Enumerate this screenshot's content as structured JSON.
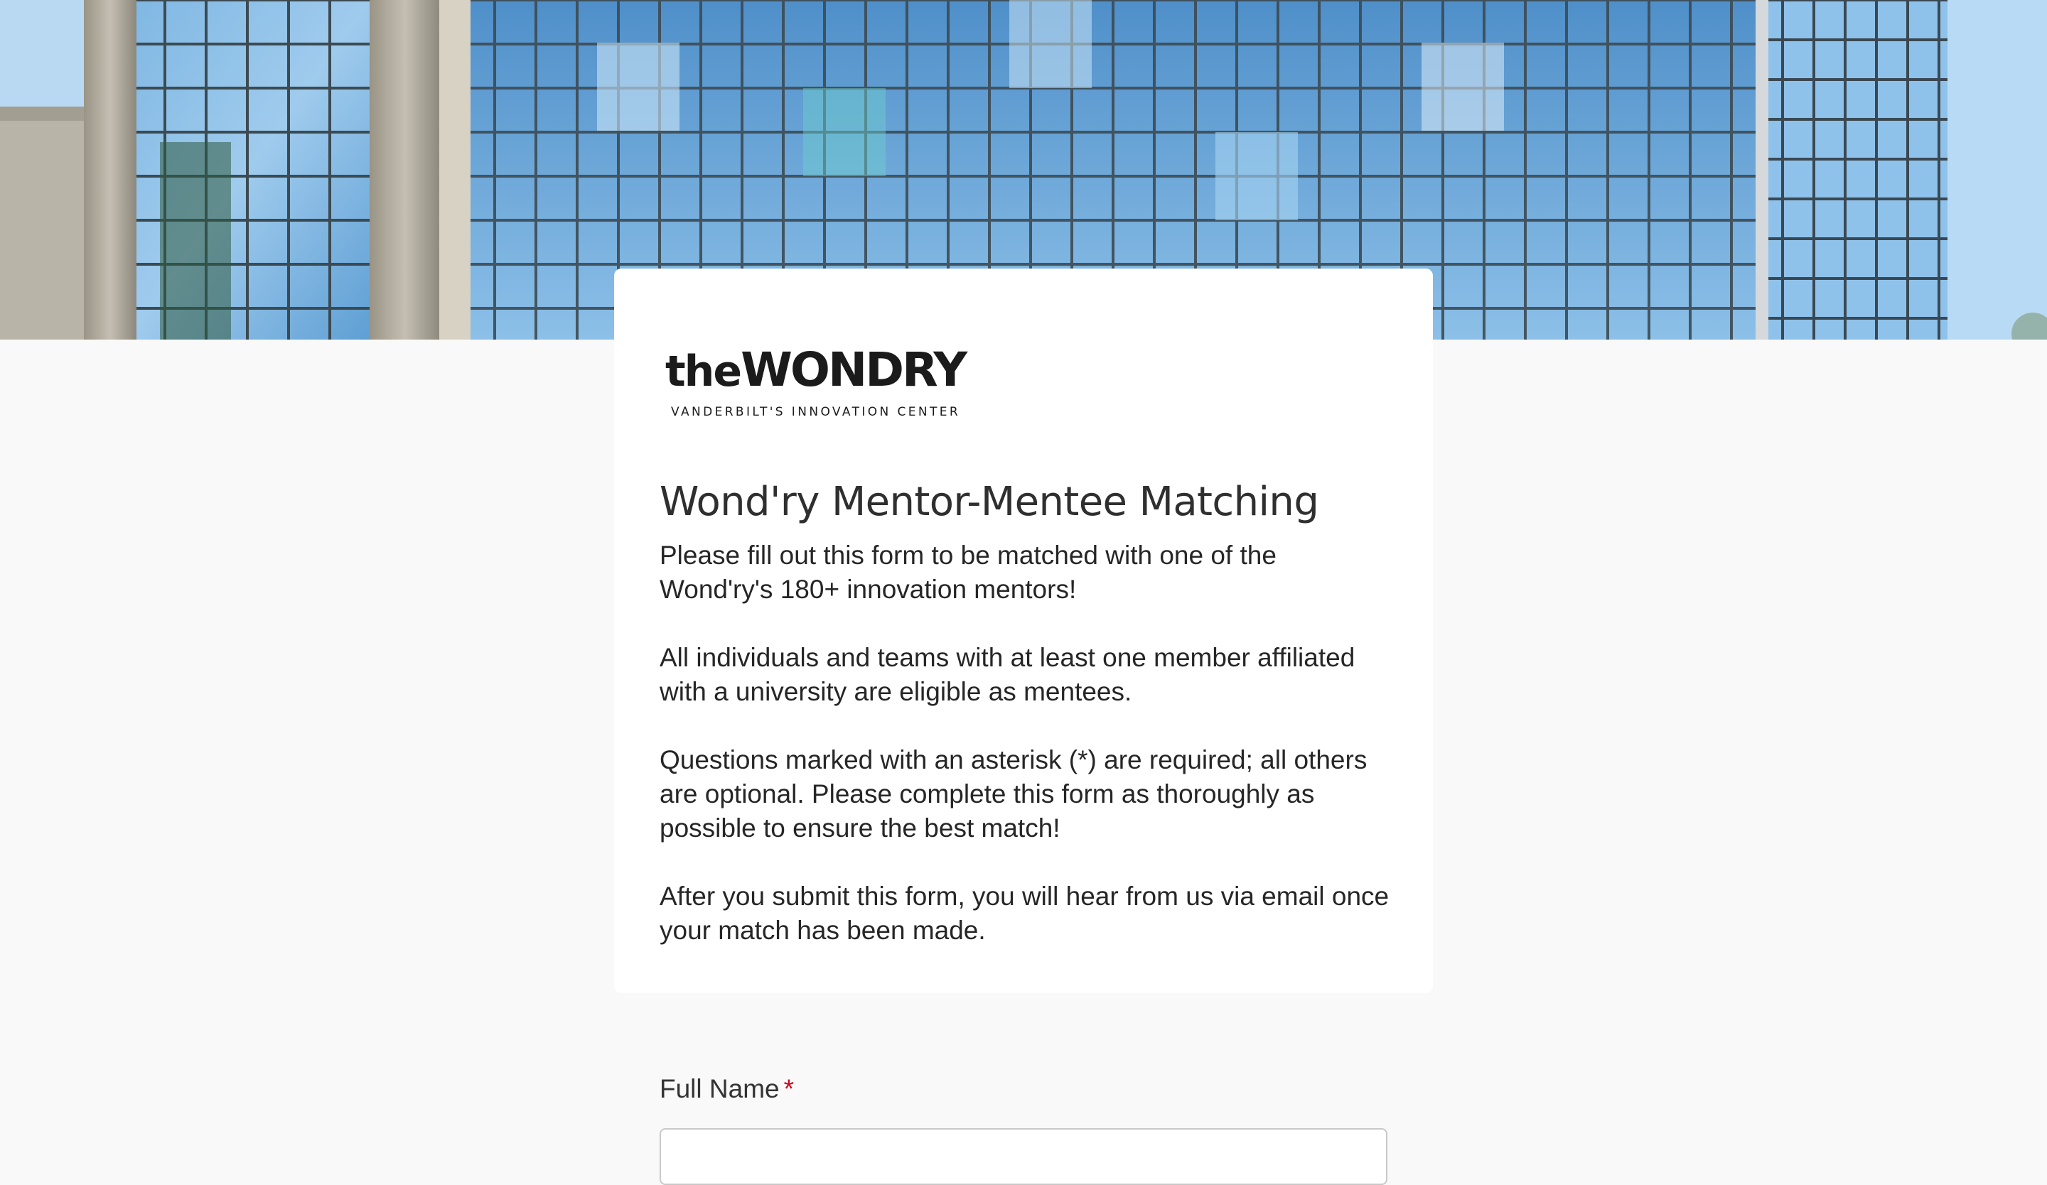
{
  "hero": {
    "image": "glass-building-facade"
  },
  "logo": {
    "the": "the",
    "wondry": "WONDRY",
    "tagline": "VANDERBILT'S INNOVATION CENTER"
  },
  "form": {
    "title": "Wond'ry Mentor-Mentee Matching",
    "description": [
      "Please fill out this form to be matched with one of the Wond'ry's 180+ innovation mentors!",
      "All individuals and teams with at least one member affiliated with a university are eligible as mentees.",
      "Questions marked with an asterisk (*) are required; all others are optional. Please complete this form as thoroughly as possible to ensure the best match!",
      "After you submit this form, you will hear from us via email once your match has been made."
    ]
  },
  "questions": [
    {
      "label": "Full Name",
      "required_marker": "*",
      "value": ""
    }
  ],
  "colors": {
    "page_background": "#f9f9f9",
    "card_background": "#ffffff",
    "required": "#d0021b",
    "text": "#262626"
  }
}
